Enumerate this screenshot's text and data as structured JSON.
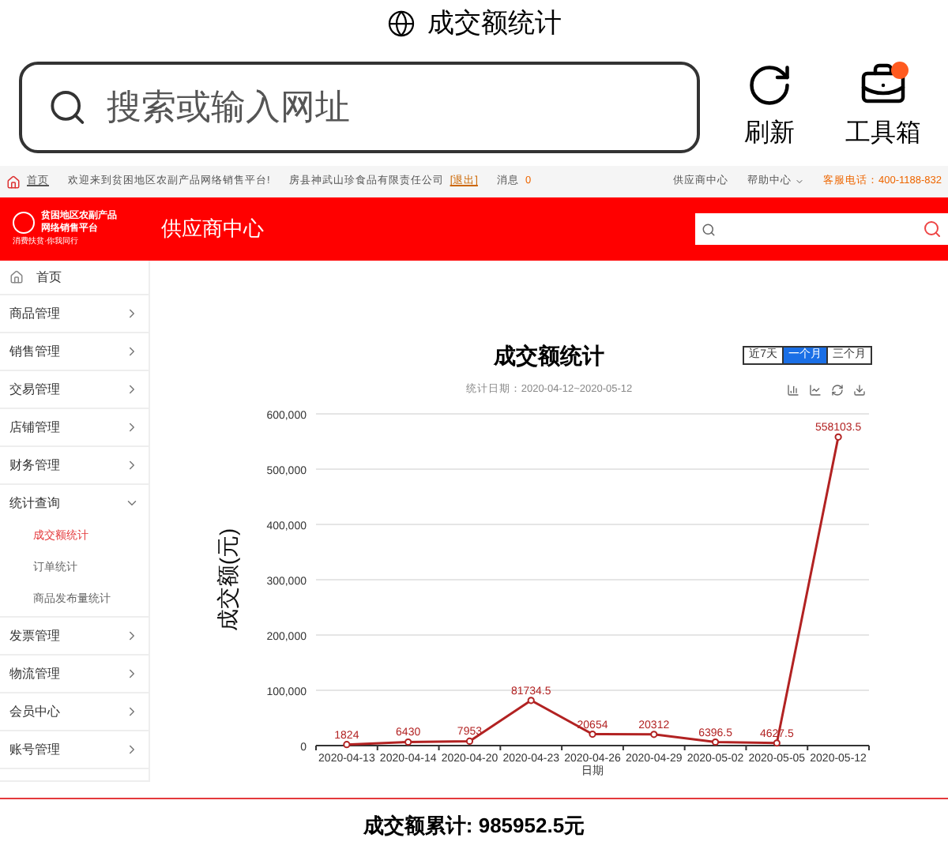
{
  "browser": {
    "title": "成交额统计",
    "search": {
      "placeholder": "搜索或输入网址"
    },
    "buttons": [
      {
        "kind": "refresh",
        "label": "刷新",
        "badge": false
      },
      {
        "kind": "toolbox",
        "label": "工具箱",
        "badge": true
      }
    ]
  },
  "topbar": {
    "home": "首页",
    "welcome": "欢迎来到贫困地区农副产品网络销售平台!",
    "company": "房县神武山珍食品有限责任公司",
    "logout": "[退出]",
    "messages": "消息",
    "message_count": "0",
    "links": [
      {
        "label": "供应商中心",
        "dropdown": false
      },
      {
        "label": "帮助中心",
        "dropdown": true
      }
    ],
    "phone": "客服电话：400-1188-832"
  },
  "header": {
    "logo_lines": [
      "贫困地区农副产品",
      "网络销售平台"
    ],
    "slogan": "消费扶贫·你我同行",
    "title": "供应商中心"
  },
  "sidebar": {
    "home": "首页",
    "items": [
      {
        "label": "商品管理",
        "expanded": false
      },
      {
        "label": "销售管理",
        "expanded": false
      },
      {
        "label": "交易管理",
        "expanded": false
      },
      {
        "label": "店铺管理",
        "expanded": false
      },
      {
        "label": "财务管理",
        "expanded": false
      },
      {
        "label": "统计查询",
        "expanded": true,
        "children": [
          {
            "label": "成交额统计",
            "selected": true
          },
          {
            "label": "订单统计",
            "selected": false
          },
          {
            "label": "商品发布量统计",
            "selected": false
          }
        ]
      },
      {
        "label": "发票管理",
        "expanded": false
      },
      {
        "label": "物流管理",
        "expanded": false
      },
      {
        "label": "会员中心",
        "expanded": false
      },
      {
        "label": "账号管理",
        "expanded": false
      }
    ]
  },
  "report": {
    "title": "成交额统计",
    "date_range": "统计日期：2020-04-12~2020-05-12",
    "ranges": [
      {
        "label": "近7天",
        "selected": false
      },
      {
        "label": "一个月",
        "selected": true
      },
      {
        "label": "三个月",
        "selected": false
      }
    ],
    "chart_data": {
      "type": "line",
      "xlabel": "日期",
      "ylabel": "成交额(元)",
      "categories": [
        "2020-04-13",
        "2020-04-14",
        "2020-04-20",
        "2020-04-23",
        "2020-04-26",
        "2020-04-29",
        "2020-05-02",
        "2020-05-05",
        "2020-05-12"
      ],
      "grid": true,
      "series": [
        {
          "color": "#b22222",
          "marker": true,
          "values": [
            1824,
            6430,
            7953,
            81734.5,
            20654,
            20312,
            6396.5,
            4627.5,
            558103.5
          ]
        }
      ],
      "ylim": [
        0,
        600000
      ],
      "yticks": [
        {
          "value": 0,
          "label": "0"
        },
        {
          "value": 100000,
          "label": "100,000"
        },
        {
          "value": 200000,
          "label": "200,000"
        },
        {
          "value": 300000,
          "label": "300,000"
        },
        {
          "value": 400000,
          "label": "400,000"
        },
        {
          "value": 500000,
          "label": "500,000"
        },
        {
          "value": 600000,
          "label": "600,000"
        }
      ],
      "data_labels": true
    },
    "total": "成交额累计: 985952.5元"
  }
}
